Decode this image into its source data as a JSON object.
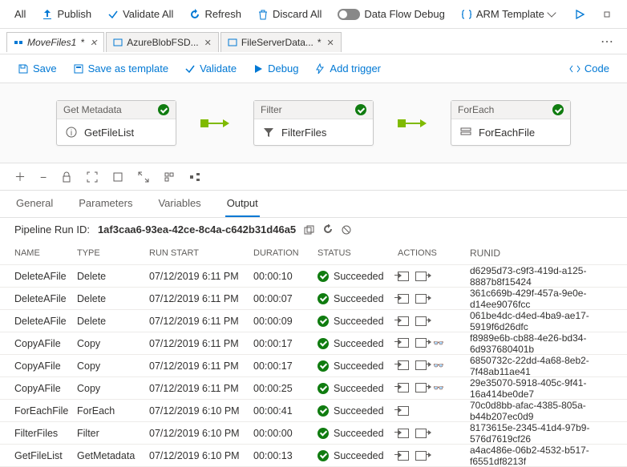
{
  "toolbar": {
    "all": "All",
    "publish": "Publish",
    "validate_all": "Validate All",
    "refresh": "Refresh",
    "discard_all": "Discard All",
    "debug": "Data Flow Debug",
    "arm": "ARM Template"
  },
  "tabs": [
    {
      "label": "MoveFiles1",
      "active": true,
      "edited": true
    },
    {
      "label": "AzureBlobFSD...",
      "active": false
    },
    {
      "label": "FileServerData...",
      "active": false,
      "edited": true
    }
  ],
  "subtoolbar": {
    "save": "Save",
    "save_as": "Save as template",
    "validate": "Validate",
    "debug": "Debug",
    "add_trigger": "Add trigger",
    "code": "Code"
  },
  "nodes": [
    {
      "type": "Get Metadata",
      "name": "GetFileList"
    },
    {
      "type": "Filter",
      "name": "FilterFiles"
    },
    {
      "type": "ForEach",
      "name": "ForEachFile"
    }
  ],
  "subtabs": {
    "general": "General",
    "parameters": "Parameters",
    "variables": "Variables",
    "output": "Output"
  },
  "run": {
    "label": "Pipeline Run ID:",
    "id": "1af3caa6-93ea-42ce-8c4a-c642b31d46a5"
  },
  "columns": {
    "name": "Name",
    "type": "Type",
    "start": "Run Start",
    "duration": "Duration",
    "status": "Status",
    "actions": "Actions",
    "runid": "RunID"
  },
  "status_succeeded": "Succeeded",
  "rows": [
    {
      "name": "DeleteAFile",
      "type": "Delete",
      "start": "07/12/2019 6:11 PM",
      "dur": "00:00:10",
      "glasses": false,
      "runid": "d6295d73-c9f3-419d-a125-8887b8f15424"
    },
    {
      "name": "DeleteAFile",
      "type": "Delete",
      "start": "07/12/2019 6:11 PM",
      "dur": "00:00:07",
      "glasses": false,
      "runid": "361c669b-429f-457a-9e0e-d14ee9076fcc"
    },
    {
      "name": "DeleteAFile",
      "type": "Delete",
      "start": "07/12/2019 6:11 PM",
      "dur": "00:00:09",
      "glasses": false,
      "runid": "061be4dc-d4ed-4ba9-ae17-5919f6d26dfc"
    },
    {
      "name": "CopyAFile",
      "type": "Copy",
      "start": "07/12/2019 6:11 PM",
      "dur": "00:00:17",
      "glasses": true,
      "runid": "f8989e6b-cb88-4e26-bd34-6d937680401b"
    },
    {
      "name": "CopyAFile",
      "type": "Copy",
      "start": "07/12/2019 6:11 PM",
      "dur": "00:00:17",
      "glasses": true,
      "runid": "6850732c-22dd-4a68-8eb2-7f48ab11ae41"
    },
    {
      "name": "CopyAFile",
      "type": "Copy",
      "start": "07/12/2019 6:11 PM",
      "dur": "00:00:25",
      "glasses": true,
      "runid": "29e35070-5918-405c-9f41-16a414be0de7"
    },
    {
      "name": "ForEachFile",
      "type": "ForEach",
      "start": "07/12/2019 6:10 PM",
      "dur": "00:00:41",
      "in_only": true,
      "runid": "70c0d8bb-afac-4385-805a-b44b207ec0d9"
    },
    {
      "name": "FilterFiles",
      "type": "Filter",
      "start": "07/12/2019 6:10 PM",
      "dur": "00:00:00",
      "glasses": false,
      "runid": "8173615e-2345-41d4-97b9-576d7619cf26"
    },
    {
      "name": "GetFileList",
      "type": "GetMetadata",
      "start": "07/12/2019 6:10 PM",
      "dur": "00:00:13",
      "glasses": false,
      "runid": "a4ac486e-06b2-4532-b517-f6551df8213f"
    }
  ]
}
